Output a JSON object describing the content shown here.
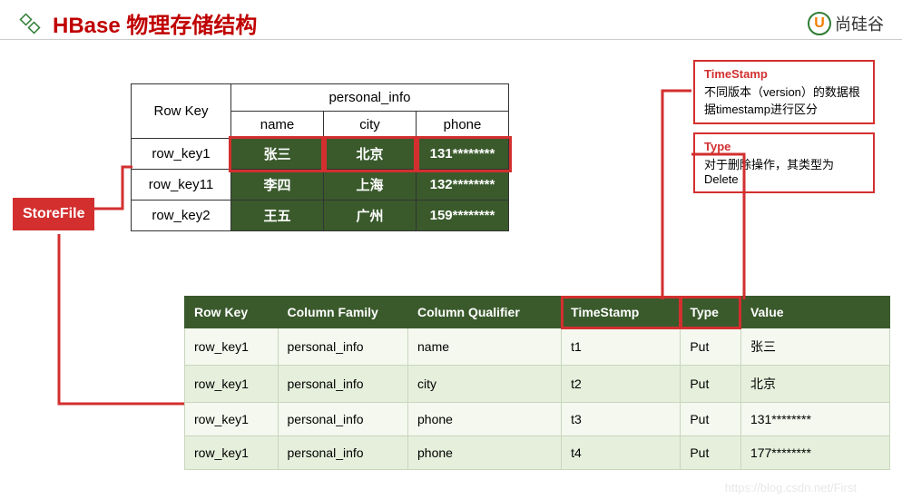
{
  "page": {
    "title": "HBase 物理存储结构",
    "brand": "尚硅谷"
  },
  "labels": {
    "storefile": "StoreFile"
  },
  "logical_table": {
    "family": "personal_info",
    "rowkey_header": "Row Key",
    "columns": [
      "name",
      "city",
      "phone"
    ],
    "rows": [
      {
        "rowkey": "row_key1",
        "cells": [
          "张三",
          "北京",
          "131********"
        ],
        "selected": true
      },
      {
        "rowkey": "row_key11",
        "cells": [
          "李四",
          "上海",
          "132********"
        ],
        "selected": false
      },
      {
        "rowkey": "row_key2",
        "cells": [
          "王五",
          "广州",
          "159********"
        ],
        "selected": false
      }
    ]
  },
  "physical_table": {
    "headers": [
      "Row Key",
      "Column Family",
      "Column Qualifier",
      "TimeStamp",
      "Type",
      "Value"
    ],
    "highlight_header_idx": [
      3,
      4
    ],
    "rows": [
      [
        "row_key1",
        "personal_info",
        "name",
        "t1",
        "Put",
        "张三"
      ],
      [
        "row_key1",
        "personal_info",
        "city",
        "t2",
        "Put",
        "北京"
      ],
      [
        "row_key1",
        "personal_info",
        "phone",
        "t3",
        "Put",
        "131********"
      ],
      [
        "row_key1",
        "personal_info",
        "phone",
        "t4",
        "Put",
        "177********"
      ]
    ]
  },
  "callouts": {
    "timestamp": {
      "title": "TimeStamp",
      "body": "不同版本（version）的数据根据timestamp进行区分"
    },
    "type": {
      "title": "Type",
      "body": "对于删除操作，其类型为Delete"
    }
  },
  "watermark": "https://blog.csdn.net/First"
}
